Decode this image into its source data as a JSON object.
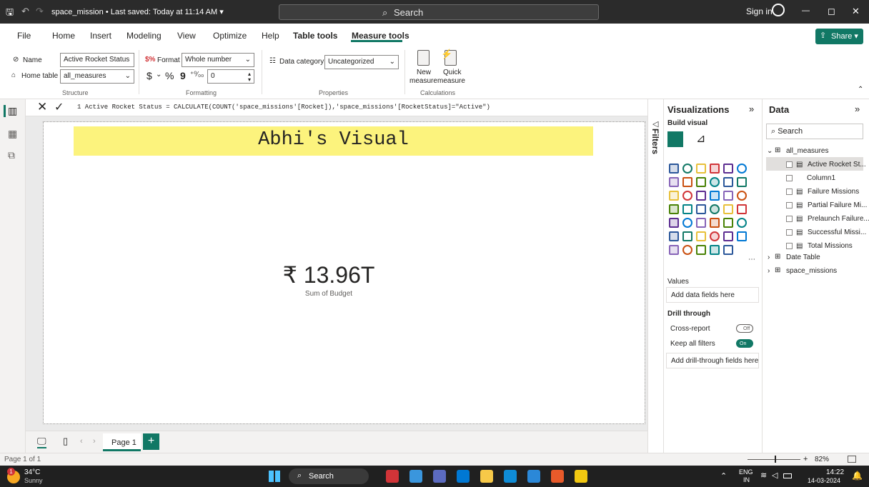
{
  "titlebar": {
    "file_title": "space_mission • Last saved: Today at 11:14 AM ▾",
    "search": "Search",
    "sign_in": "Sign in",
    "minimize": "—",
    "restore": "◻",
    "close": "✕"
  },
  "menu": {
    "items": [
      "File",
      "Home",
      "Insert",
      "Modeling",
      "View",
      "Optimize",
      "Help",
      "Table tools",
      "Measure tools"
    ],
    "share": "Share ▾"
  },
  "ribbon": {
    "name_label": "Name",
    "name_value": "Active Rocket Status",
    "home_table_label": "Home table",
    "home_table_value": "all_measures",
    "structure_group": "Structure",
    "format_label": "Format",
    "format_value": "Whole number",
    "currency": "$",
    "percent": "%",
    "comma": "9",
    "decimal_places": "0",
    "formatting_group": "Formatting",
    "data_category_label": "Data category",
    "data_category_value": "Uncategorized",
    "properties_group": "Properties",
    "new_measure_1": "New",
    "new_measure_2": "measure",
    "quick_measure_1": "Quick",
    "quick_measure_2": "measure",
    "calculations_group": "Calculations"
  },
  "formula": {
    "text": "1  Active Rocket Status = CALCULATE(COUNT('space_missions'[Rocket]),'space_missions'[RocketStatus]=\"Active\")"
  },
  "canvas": {
    "banner_title": "Abhi's Visual",
    "kpi_value": "₹ 13.96T",
    "kpi_label": "Sum of Budget"
  },
  "pages": {
    "tab": "Page 1",
    "add": "+",
    "status": "Page 1 of 1",
    "zoom": "82%"
  },
  "filters": {
    "label": "Filters"
  },
  "visualizations": {
    "title": "Visualizations",
    "build_visual": "Build visual",
    "values_label": "Values",
    "values_placeholder": "Add data fields here",
    "drill_through": "Drill through",
    "cross_report": "Cross-report",
    "cross_report_state": "Off",
    "keep_all_filters": "Keep all filters",
    "keep_all_filters_state": "On",
    "drill_placeholder": "Add drill-through fields here",
    "icon_colors": [
      "#2b579a",
      "#117865",
      "#e8c03a",
      "#d13438",
      "#5c2d91",
      "#0078d4",
      "#8764b8",
      "#ca5010",
      "#498205",
      "#038387"
    ]
  },
  "data": {
    "title": "Data",
    "search": "Search",
    "tables": [
      {
        "name": "all_measures",
        "items": [
          "Active Rocket St...",
          "Column1",
          "Failure Missions",
          "Partial Failure Mi...",
          "Prelaunch Failure...",
          "Successful Missi...",
          "Total Missions"
        ]
      },
      {
        "name": "Date Table",
        "items": []
      },
      {
        "name": "space_missions",
        "items": []
      }
    ]
  },
  "taskbar": {
    "temp": "34°C",
    "weather": "Sunny",
    "search": "Search",
    "lang_1": "ENG",
    "lang_2": "IN",
    "time": "14:22",
    "date": "14-03-2024",
    "notification": "1"
  }
}
